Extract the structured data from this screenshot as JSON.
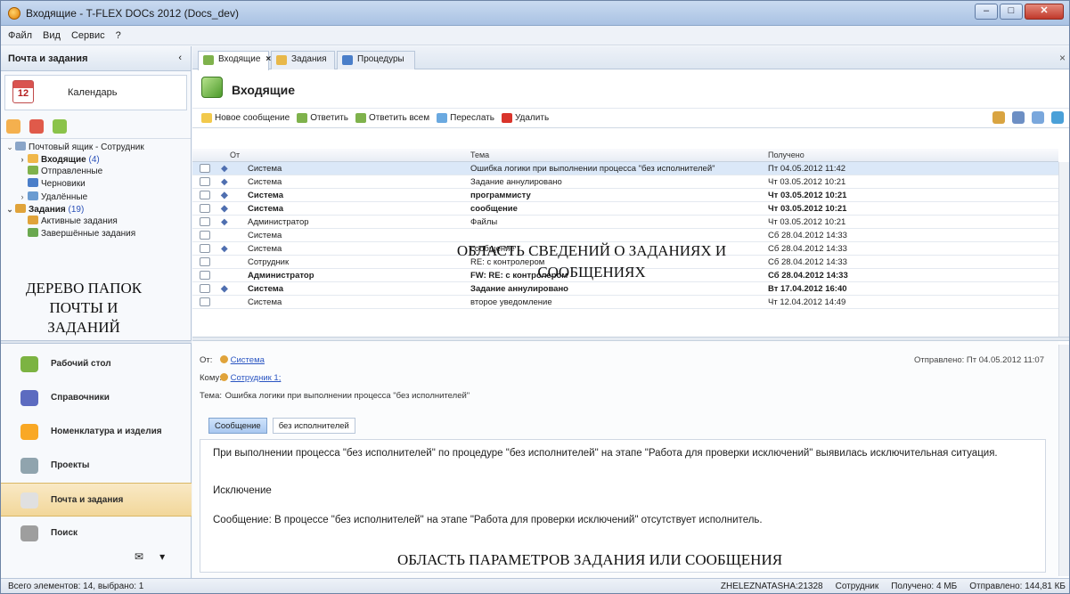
{
  "window": {
    "title": "Входящие - T-FLEX DOCs 2012 (Docs_dev)"
  },
  "menu": [
    "Файл",
    "Вид",
    "Сервис",
    "?"
  ],
  "left_panel": {
    "header": "Почта и задания",
    "calendar": {
      "label": "Календарь",
      "day": "12"
    },
    "tree": [
      {
        "label": "Почтовый ящик - Сотрудник",
        "count": "",
        "level": 0,
        "bold": false,
        "expander": "⌄"
      },
      {
        "label": "Входящие",
        "count": "(4)",
        "level": 1,
        "bold": true,
        "expander": "›"
      },
      {
        "label": "Отправленные",
        "count": "",
        "level": 1,
        "bold": false,
        "expander": ""
      },
      {
        "label": "Черновики",
        "count": "",
        "level": 1,
        "bold": false,
        "expander": ""
      },
      {
        "label": "Удалённые",
        "count": "",
        "level": 1,
        "bold": false,
        "expander": "›"
      },
      {
        "label": "Задания",
        "count": "(19)",
        "level": 0,
        "bold": true,
        "expander": "⌄"
      },
      {
        "label": "Активные задания",
        "count": "",
        "level": 1,
        "bold": false,
        "expander": ""
      },
      {
        "label": "Завершённые задания",
        "count": "",
        "level": 1,
        "bold": false,
        "expander": ""
      }
    ],
    "overlay_label": "ДЕРЕВО ПАПОК ПОЧТЫ И ЗАДАНИЙ",
    "nav": [
      {
        "label": "Рабочий стол",
        "color": "#7cb342"
      },
      {
        "label": "Справочники",
        "color": "#5c6bc0"
      },
      {
        "label": "Номенклатура и изделия",
        "color": "#f9a825"
      },
      {
        "label": "Проекты",
        "color": "#90a4ae"
      },
      {
        "label": "Почта и задания",
        "color": "#e0e0e0"
      },
      {
        "label": "Поиск",
        "color": "#9e9e9e"
      }
    ]
  },
  "tabs": [
    {
      "label": "Входящие",
      "active": true,
      "closable": true
    },
    {
      "label": "Задания",
      "active": false,
      "closable": false
    },
    {
      "label": "Процедуры",
      "active": false,
      "closable": false
    }
  ],
  "header": {
    "title": "Входящие"
  },
  "toolbar": [
    {
      "label": "Новое сообщение",
      "color": "#f2c94c"
    },
    {
      "label": "Ответить",
      "color": "#7fb24c"
    },
    {
      "label": "Ответить всем",
      "color": "#7fb24c"
    },
    {
      "label": "Переслать",
      "color": "#6aa9e0"
    },
    {
      "label": "Удалить",
      "color": "#d9342b"
    }
  ],
  "grid": {
    "columns": [
      "От",
      "Тема",
      "Получено"
    ],
    "rows": [
      {
        "from": "Система",
        "subject": "Ошибка логики при выполнении процесса \"без исполнителей\"",
        "received": "Пт 04.05.2012 11:42",
        "bold": false,
        "attach": true,
        "selected": true
      },
      {
        "from": "Система",
        "subject": "Задание аннулировано",
        "received": "Чт 03.05.2012 10:21",
        "bold": false,
        "attach": true,
        "selected": false
      },
      {
        "from": "Система",
        "subject": "программисту",
        "received": "Чт 03.05.2012 10:21",
        "bold": true,
        "attach": true,
        "selected": false
      },
      {
        "from": "Система",
        "subject": "сообщение",
        "received": "Чт 03.05.2012 10:21",
        "bold": true,
        "attach": true,
        "selected": false
      },
      {
        "from": "Администратор",
        "subject": "Файлы",
        "received": "Чт 03.05.2012 10:21",
        "bold": false,
        "attach": true,
        "selected": false
      },
      {
        "from": "Система",
        "subject": "",
        "received": "Сб 28.04.2012 14:33",
        "bold": false,
        "attach": false,
        "selected": false
      },
      {
        "from": "Система",
        "subject": "сообщение",
        "received": "Сб 28.04.2012 14:33",
        "bold": false,
        "attach": true,
        "selected": false
      },
      {
        "from": "Сотрудник",
        "subject": "RE: с контролером",
        "received": "Сб 28.04.2012 14:33",
        "bold": false,
        "attach": false,
        "selected": false
      },
      {
        "from": "Администратор",
        "subject": "FW: RE: с контролером",
        "received": "Сб 28.04.2012 14:33",
        "bold": true,
        "attach": false,
        "selected": false
      },
      {
        "from": "Система",
        "subject": "Задание аннулировано",
        "received": "Вт 17.04.2012 16:40",
        "bold": true,
        "attach": true,
        "selected": false
      },
      {
        "from": "Система",
        "subject": "второе уведомление",
        "received": "Чт 12.04.2012 14:49",
        "bold": false,
        "attach": false,
        "selected": false
      }
    ],
    "overlay_label": "ОБЛАСТЬ СВЕДЕНИЙ О ЗАДАНИЯХ И СООБЩЕНИЯХ"
  },
  "preview": {
    "from_label": "От:",
    "from_value": "Система",
    "to_label": "Кому:",
    "to_value": "Сотрудник 1;",
    "subject_label": "Тема:",
    "subject_value": "Ошибка логики при выполнении процесса \"без исполнителей\"",
    "sent_label": "Отправлено:",
    "sent_value": "Пт 04.05.2012 11:07",
    "tabs": [
      "Сообщение",
      "без исполнителей"
    ],
    "body_line1": "При выполнении процесса \"без исполнителей\" по процедуре \"без исполнителей\" на этапе \"Работа для проверки исключений\" выявилась исключительная ситуация.",
    "body_exception": "Исключение",
    "body_line2": "Сообщение: В процессе \"без исполнителей\" на этапе \"Работа для проверки исключений\" отсутствует исполнитель.",
    "overlay_label": "ОБЛАСТЬ ПАРАМЕТРОВ ЗАДАНИЯ ИЛИ СООБЩЕНИЯ"
  },
  "status": {
    "left": "Всего элементов: 14, выбрано: 1",
    "user": "ZHELEZNATASHA:21328",
    "role": "Сотрудник",
    "received": "Получено: 4 МБ",
    "sent": "Отправлено: 144,81 КБ"
  }
}
